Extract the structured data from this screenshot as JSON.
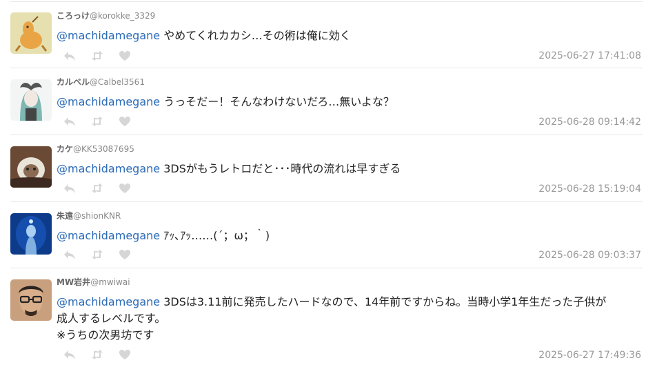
{
  "tweets": [
    {
      "name": "ころっけ",
      "handle": "@korokke_3329",
      "mention": "@machidamegane",
      "lines": [
        "やめてくれカカシ…その術は俺に効く"
      ],
      "time": "2025-06-27 17:41:08",
      "avatar_colors": {
        "bg": "#e6dfb0",
        "fg": "#e9a545"
      }
    },
    {
      "name": "カルベル",
      "handle": "@Calbel3561",
      "mention": "@machidamegane",
      "lines": [
        "うっそだー！そんなわけないだろ…無いよな？"
      ],
      "time": "2025-06-28 09:14:42",
      "avatar_colors": {
        "bg": "#f3f5f5",
        "fg": "#7fb7b3"
      }
    },
    {
      "name": "カケ",
      "handle": "@KK53087695",
      "mention": "@machidamegane",
      "lines": [
        "3DSがもうレトロだと･･･時代の流れは早すぎる"
      ],
      "time": "2025-06-28 15:19:04",
      "avatar_colors": {
        "bg": "#6b4a35",
        "fg": "#e9e4da"
      }
    },
    {
      "name": "朱遠",
      "handle": "@shionKNR",
      "mention": "@machidamegane",
      "lines": [
        "ｱｯ､ｱｯ……(´；ω；｀)"
      ],
      "time": "2025-06-28 09:03:37",
      "avatar_colors": {
        "bg": "#0d3b8a",
        "fg": "#a9d0f2"
      }
    },
    {
      "name": "MW岩井",
      "handle": "@mwiwai",
      "mention": "@machidamegane",
      "lines": [
        "3DSは3.11前に発売したハードなので、14年前ですからね。当時小学1年生だった子供が",
        "成人するレベルです。",
        "※うちの次男坊です"
      ],
      "time": "2025-06-27 17:49:36",
      "avatar_colors": {
        "bg": "#c9a07e",
        "fg": "#3a2a20"
      }
    }
  ],
  "action_icons": [
    "reply-icon",
    "retweet-icon",
    "like-icon"
  ],
  "colors": {
    "mention": "#2a6ab8",
    "muted": "#999999",
    "icon": "#d6d6d6",
    "divider": "#e6e6e6"
  }
}
